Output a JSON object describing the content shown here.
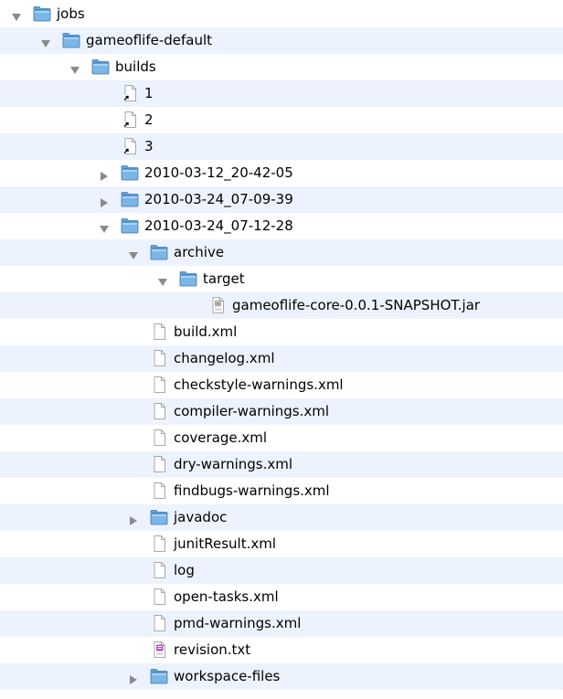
{
  "colors": {
    "row_alt": "#edf3fe",
    "row_plain": "#ffffff",
    "folder_fill": "#7ab6e6",
    "folder_tab": "#6aa6d8",
    "folder_outline": "#3c78b4",
    "disclosure": "#8a8a8a",
    "doc_outline": "#a8a8a8"
  },
  "tree": [
    {
      "label": "jobs",
      "icon": "folder-icon",
      "disclosure": "expanded",
      "depth": 0
    },
    {
      "label": "gameoflife-default",
      "icon": "folder-icon",
      "disclosure": "expanded",
      "depth": 1
    },
    {
      "label": "builds",
      "icon": "folder-icon",
      "disclosure": "expanded",
      "depth": 2
    },
    {
      "label": "1",
      "icon": "alias-file-icon",
      "disclosure": "none",
      "depth": 3
    },
    {
      "label": "2",
      "icon": "alias-file-icon",
      "disclosure": "none",
      "depth": 3
    },
    {
      "label": "3",
      "icon": "alias-file-icon",
      "disclosure": "none",
      "depth": 3
    },
    {
      "label": "2010-03-12_20-42-05",
      "icon": "folder-icon",
      "disclosure": "collapsed",
      "depth": 3
    },
    {
      "label": "2010-03-24_07-09-39",
      "icon": "folder-icon",
      "disclosure": "collapsed",
      "depth": 3
    },
    {
      "label": "2010-03-24_07-12-28",
      "icon": "folder-icon",
      "disclosure": "expanded",
      "depth": 3
    },
    {
      "label": "archive",
      "icon": "folder-icon",
      "disclosure": "expanded",
      "depth": 4
    },
    {
      "label": "target",
      "icon": "folder-icon",
      "disclosure": "expanded",
      "depth": 5
    },
    {
      "label": "gameoflife-core-0.0.1-SNAPSHOT.jar",
      "icon": "jar-file-icon",
      "disclosure": "none",
      "depth": 6
    },
    {
      "label": "build.xml",
      "icon": "document-icon",
      "disclosure": "none",
      "depth": 4
    },
    {
      "label": "changelog.xml",
      "icon": "document-icon",
      "disclosure": "none",
      "depth": 4
    },
    {
      "label": "checkstyle-warnings.xml",
      "icon": "document-icon",
      "disclosure": "none",
      "depth": 4
    },
    {
      "label": "compiler-warnings.xml",
      "icon": "document-icon",
      "disclosure": "none",
      "depth": 4
    },
    {
      "label": "coverage.xml",
      "icon": "document-icon",
      "disclosure": "none",
      "depth": 4
    },
    {
      "label": "dry-warnings.xml",
      "icon": "document-icon",
      "disclosure": "none",
      "depth": 4
    },
    {
      "label": "findbugs-warnings.xml",
      "icon": "document-icon",
      "disclosure": "none",
      "depth": 4
    },
    {
      "label": "javadoc",
      "icon": "folder-icon",
      "disclosure": "collapsed",
      "depth": 4
    },
    {
      "label": "junitResult.xml",
      "icon": "document-icon",
      "disclosure": "none",
      "depth": 4
    },
    {
      "label": "log",
      "icon": "document-icon",
      "disclosure": "none",
      "depth": 4
    },
    {
      "label": "open-tasks.xml",
      "icon": "document-icon",
      "disclosure": "none",
      "depth": 4
    },
    {
      "label": "pmd-warnings.xml",
      "icon": "document-icon",
      "disclosure": "none",
      "depth": 4
    },
    {
      "label": "revision.txt",
      "icon": "text-file-icon",
      "disclosure": "none",
      "depth": 4
    },
    {
      "label": "workspace-files",
      "icon": "folder-icon",
      "disclosure": "collapsed",
      "depth": 4
    }
  ]
}
